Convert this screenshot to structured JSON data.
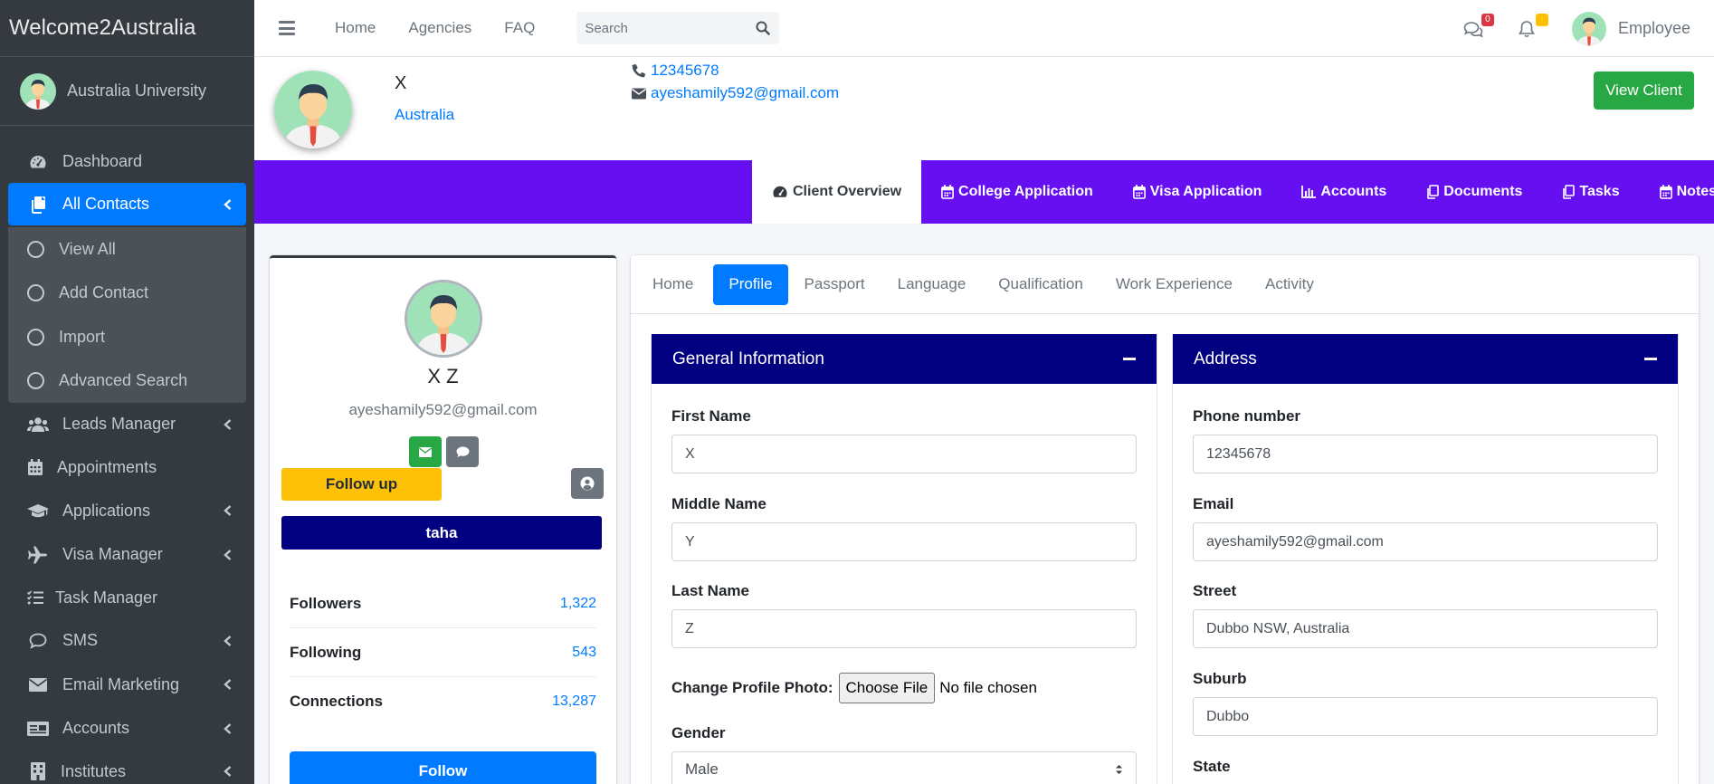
{
  "sidebar": {
    "brand": "Welcome2Australia",
    "user_name": "Australia University",
    "items": [
      {
        "label": "Dashboard",
        "icon": "tachometer-icon"
      },
      {
        "label": "All Contacts",
        "icon": "copy-icon",
        "active": true
      },
      {
        "label": "Leads Manager",
        "icon": "users-icon"
      },
      {
        "label": "Appointments",
        "icon": "calendar-icon"
      },
      {
        "label": "Applications",
        "icon": "graduation-cap-icon"
      },
      {
        "label": "Visa Manager",
        "icon": "plane-icon"
      },
      {
        "label": "Task Manager",
        "icon": "tasks-icon"
      },
      {
        "label": "SMS",
        "icon": "comment-icon"
      },
      {
        "label": "Email Marketing",
        "icon": "envelope-icon"
      },
      {
        "label": "Accounts",
        "icon": "money-check-icon"
      },
      {
        "label": "Institutes",
        "icon": "building-icon"
      }
    ],
    "subitems": [
      "View All",
      "Add Contact",
      "Import",
      "Advanced Search"
    ]
  },
  "topbar": {
    "links": [
      "Home",
      "Agencies",
      "FAQ"
    ],
    "search_placeholder": "Search",
    "messages_count": "0",
    "notifications_count": "!",
    "user_label": "Employee"
  },
  "client": {
    "name": "X",
    "country": "Australia",
    "phone": "12345678",
    "email": "ayeshamily592@gmail.com",
    "view_client_label": "View Client"
  },
  "client_tabs": [
    {
      "label": "Client Overview",
      "icon": "tachometer-icon",
      "active": true
    },
    {
      "label": "College Application",
      "icon": "calendar-icon"
    },
    {
      "label": "Visa Application",
      "icon": "calendar-icon"
    },
    {
      "label": "Accounts",
      "icon": "chart-bar-icon"
    },
    {
      "label": "Documents",
      "icon": "copy-icon"
    },
    {
      "label": "Tasks",
      "icon": "copy-icon"
    },
    {
      "label": "Notes",
      "icon": "calendar-icon"
    }
  ],
  "profile": {
    "full_name": "X Z",
    "email": "ayeshamily592@gmail.com",
    "follow_up_label": "Follow up",
    "assigned_label": "taha",
    "stats": [
      {
        "label": "Followers",
        "value": "1,322"
      },
      {
        "label": "Following",
        "value": "543"
      },
      {
        "label": "Connections",
        "value": "13,287"
      }
    ],
    "follow_label": "Follow"
  },
  "subtabs": [
    "Home",
    "Profile",
    "Passport",
    "Language",
    "Qualification",
    "Work Experience",
    "Activity"
  ],
  "general": {
    "title": "General Information",
    "first_name_label": "First Name",
    "first_name": "X",
    "middle_name_label": "Middle Name",
    "middle_name": "Y",
    "last_name_label": "Last Name",
    "last_name": "Z",
    "photo_label": "Change Profile Photo:",
    "choose_file": "Choose File",
    "no_file": "No file chosen",
    "gender_label": "Gender",
    "gender": "Male"
  },
  "address": {
    "title": "Address",
    "phone_label": "Phone number",
    "phone": "12345678",
    "email_label": "Email",
    "email": "ayeshamily592@gmail.com",
    "street_label": "Street",
    "street": "Dubbo NSW, Australia",
    "suburb_label": "Suburb",
    "suburb": "Dubbo",
    "state_label": "State"
  },
  "colors": {
    "primary": "#007bff",
    "purple_bar": "#6610f2",
    "navy": "#000080",
    "sidebar": "#343a40",
    "success": "#28a745",
    "warning": "#ffc107"
  }
}
